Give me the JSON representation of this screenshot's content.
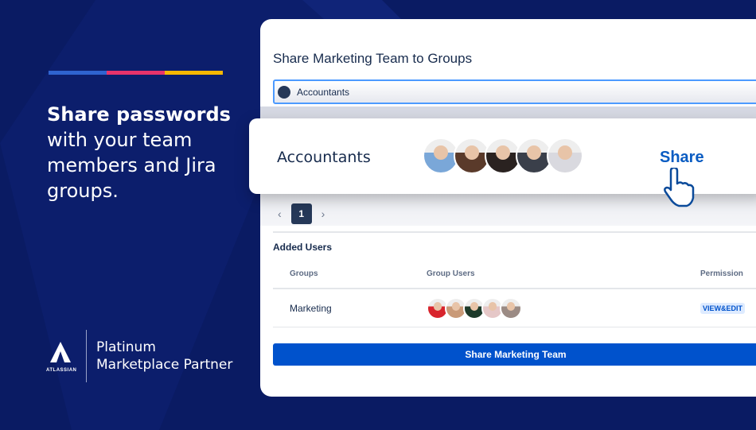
{
  "left": {
    "accent_colors": [
      "#2f64d0",
      "#e8336b",
      "#f5b700"
    ],
    "headline_bold": "Share passwords",
    "headline_rest": "with your team members and Jira groups.",
    "logo_wordmark": "ATLASSIAN",
    "partner_line1": "Platinum",
    "partner_line2": "Marketplace Partner"
  },
  "dialog": {
    "title": "Share Marketing Team to Groups",
    "input_value": "Accountants",
    "pagination": {
      "prev": "‹",
      "current": "1",
      "next": "›"
    },
    "added_users_heading": "Added Users",
    "columns": [
      "Groups",
      "Group Users",
      "Permission"
    ],
    "rows": [
      {
        "group": "Marketing",
        "permission": "VIEW&EDIT",
        "avatar_colors": [
          "#d8242c",
          "#c99a78",
          "#1d3a2a",
          "#e5c7c7",
          "#9b8b84"
        ]
      }
    ],
    "submit_label": "Share Marketing Team"
  },
  "popup": {
    "group_name": "Accountants",
    "avatar_colors": [
      "#7aa7d8",
      "#5a3a2a",
      "#2a2220",
      "#3a3f4a",
      "#d9d9df"
    ],
    "share_label": "Share"
  }
}
